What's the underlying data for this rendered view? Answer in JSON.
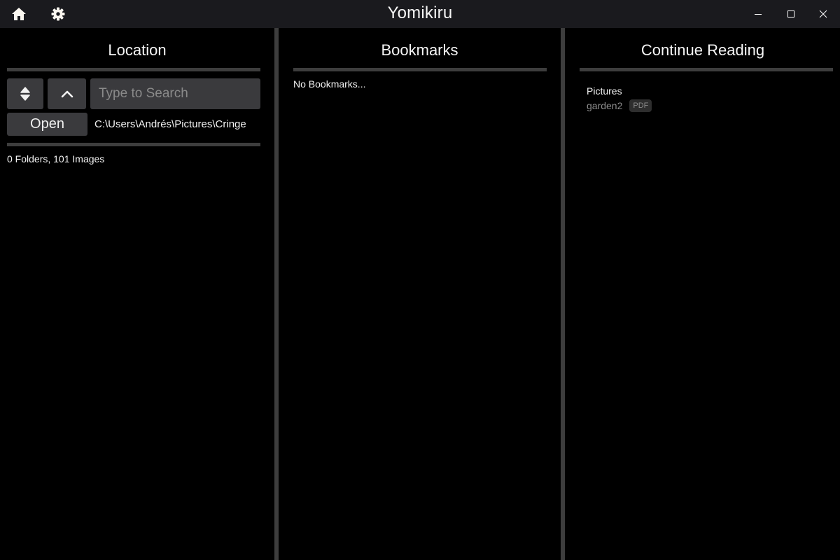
{
  "window": {
    "title": "Yomikiru",
    "icons": {
      "home": "home-icon",
      "settings": "gear-icon",
      "minimize": "minimize-icon",
      "maximize": "maximize-icon",
      "close": "close-icon"
    }
  },
  "location": {
    "title": "Location",
    "sort_icon": "sort-icon",
    "up_icon": "chevron-up-icon",
    "search_placeholder": "Type to Search",
    "search_value": "",
    "open_label": "Open",
    "current_path": "C:\\Users\\Andrés\\Pictures\\Cringe",
    "summary": "0 Folders, 101 Images"
  },
  "bookmarks": {
    "title": "Bookmarks",
    "empty_text": "No Bookmarks..."
  },
  "continue_reading": {
    "title": "Continue Reading",
    "items": [
      {
        "folder": "Pictures",
        "name": "garden2",
        "type": "PDF"
      }
    ]
  },
  "colors": {
    "titlebar_bg": "#1a1a1e",
    "panel_bg": "#000000",
    "divider": "#3d3d3d",
    "button_bg": "#3a3a3d"
  }
}
